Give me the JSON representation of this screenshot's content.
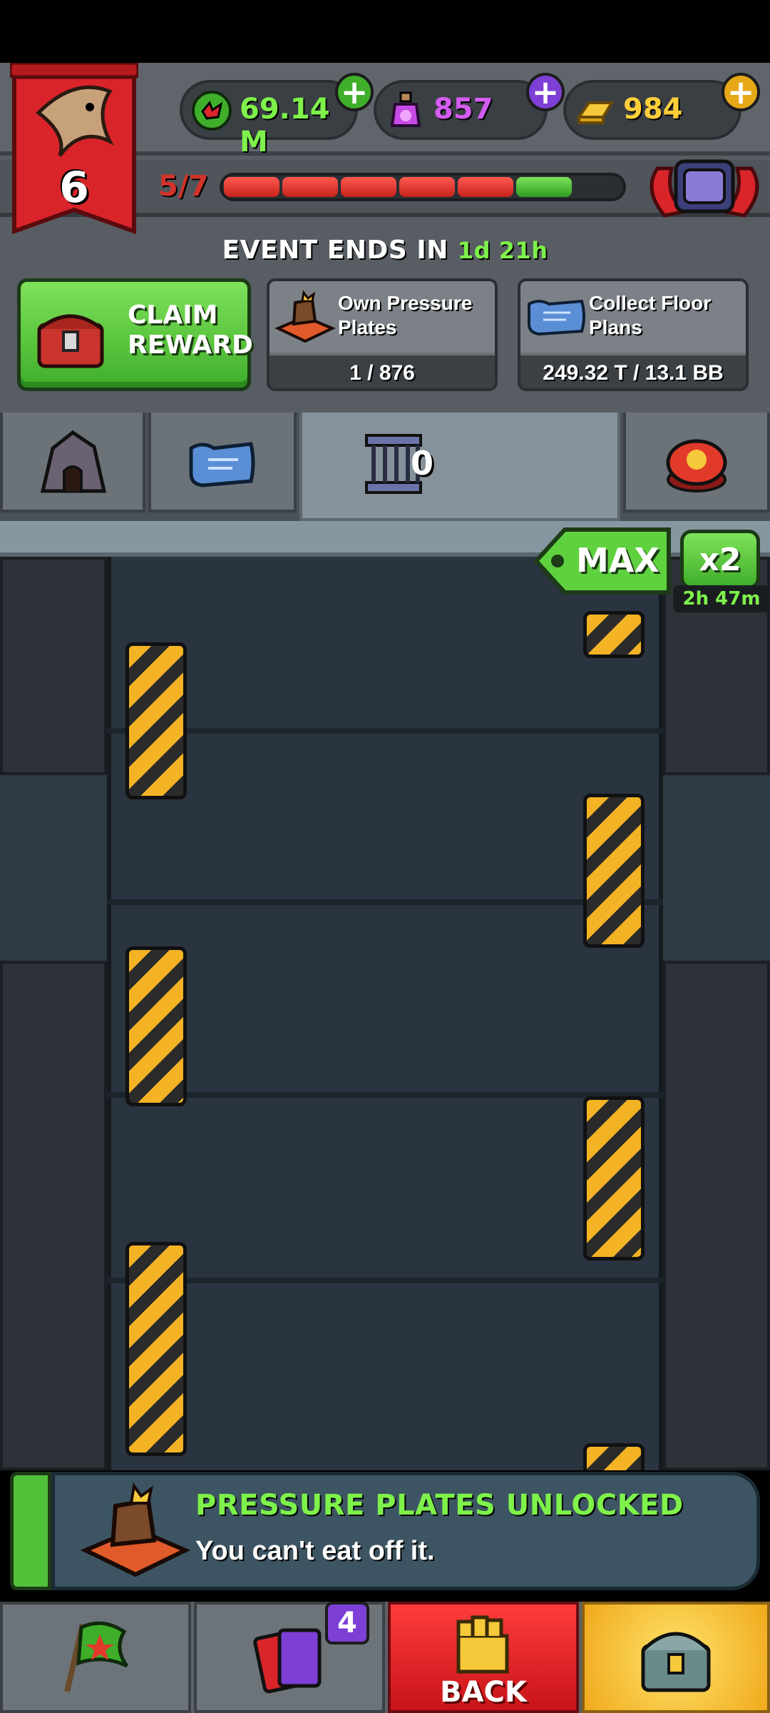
{
  "player": {
    "level": "6"
  },
  "currencies": [
    {
      "name": "cash",
      "value": "69.14 M",
      "color": "#7ef24a",
      "plus_color": "#3fae2a"
    },
    {
      "name": "potions",
      "value": "857",
      "color": "#d45cf0",
      "plus_color": "#7d3fd6"
    },
    {
      "name": "gold",
      "value": "984",
      "color": "#ffcf3a",
      "plus_color": "#e6a818"
    }
  ],
  "progress": {
    "label": "5/7",
    "segments": [
      "red",
      "red",
      "red",
      "red",
      "red",
      "green",
      "empty"
    ]
  },
  "event": {
    "prefix": "EVENT ENDS IN",
    "time": "1d 21h"
  },
  "claim": {
    "line1": "CLAIM",
    "line2": "REWARD"
  },
  "tasks": [
    {
      "title": "Own Pressure Plates",
      "progress": "1 / 876",
      "icon": "pressure-plate-icon"
    },
    {
      "title": "Collect Floor Plans",
      "progress": "249.32 T / 13.1 BB",
      "icon": "floor-plan-icon"
    }
  ],
  "tabs": [
    {
      "name": "prison-rock",
      "icon": "rock-prison-icon"
    },
    {
      "name": "floor-plans",
      "icon": "blueprint-icon"
    },
    {
      "name": "cages",
      "icon": "cage-icon",
      "count": "0",
      "active": true
    },
    {
      "name": "alarm",
      "icon": "alarm-button-icon"
    }
  ],
  "board": {
    "max_label": "MAX",
    "multiplier_label": "x2",
    "multiplier_timer": "2h 47m"
  },
  "notification": {
    "title": "PRESSURE PLATES UNLOCKED",
    "text": "You can't eat off it."
  },
  "nav": {
    "badge": "4",
    "back_label": "BACK"
  },
  "colors": {
    "accent_green": "#7ef24a",
    "danger_red": "#d2332b",
    "steel": "#8797a2"
  }
}
